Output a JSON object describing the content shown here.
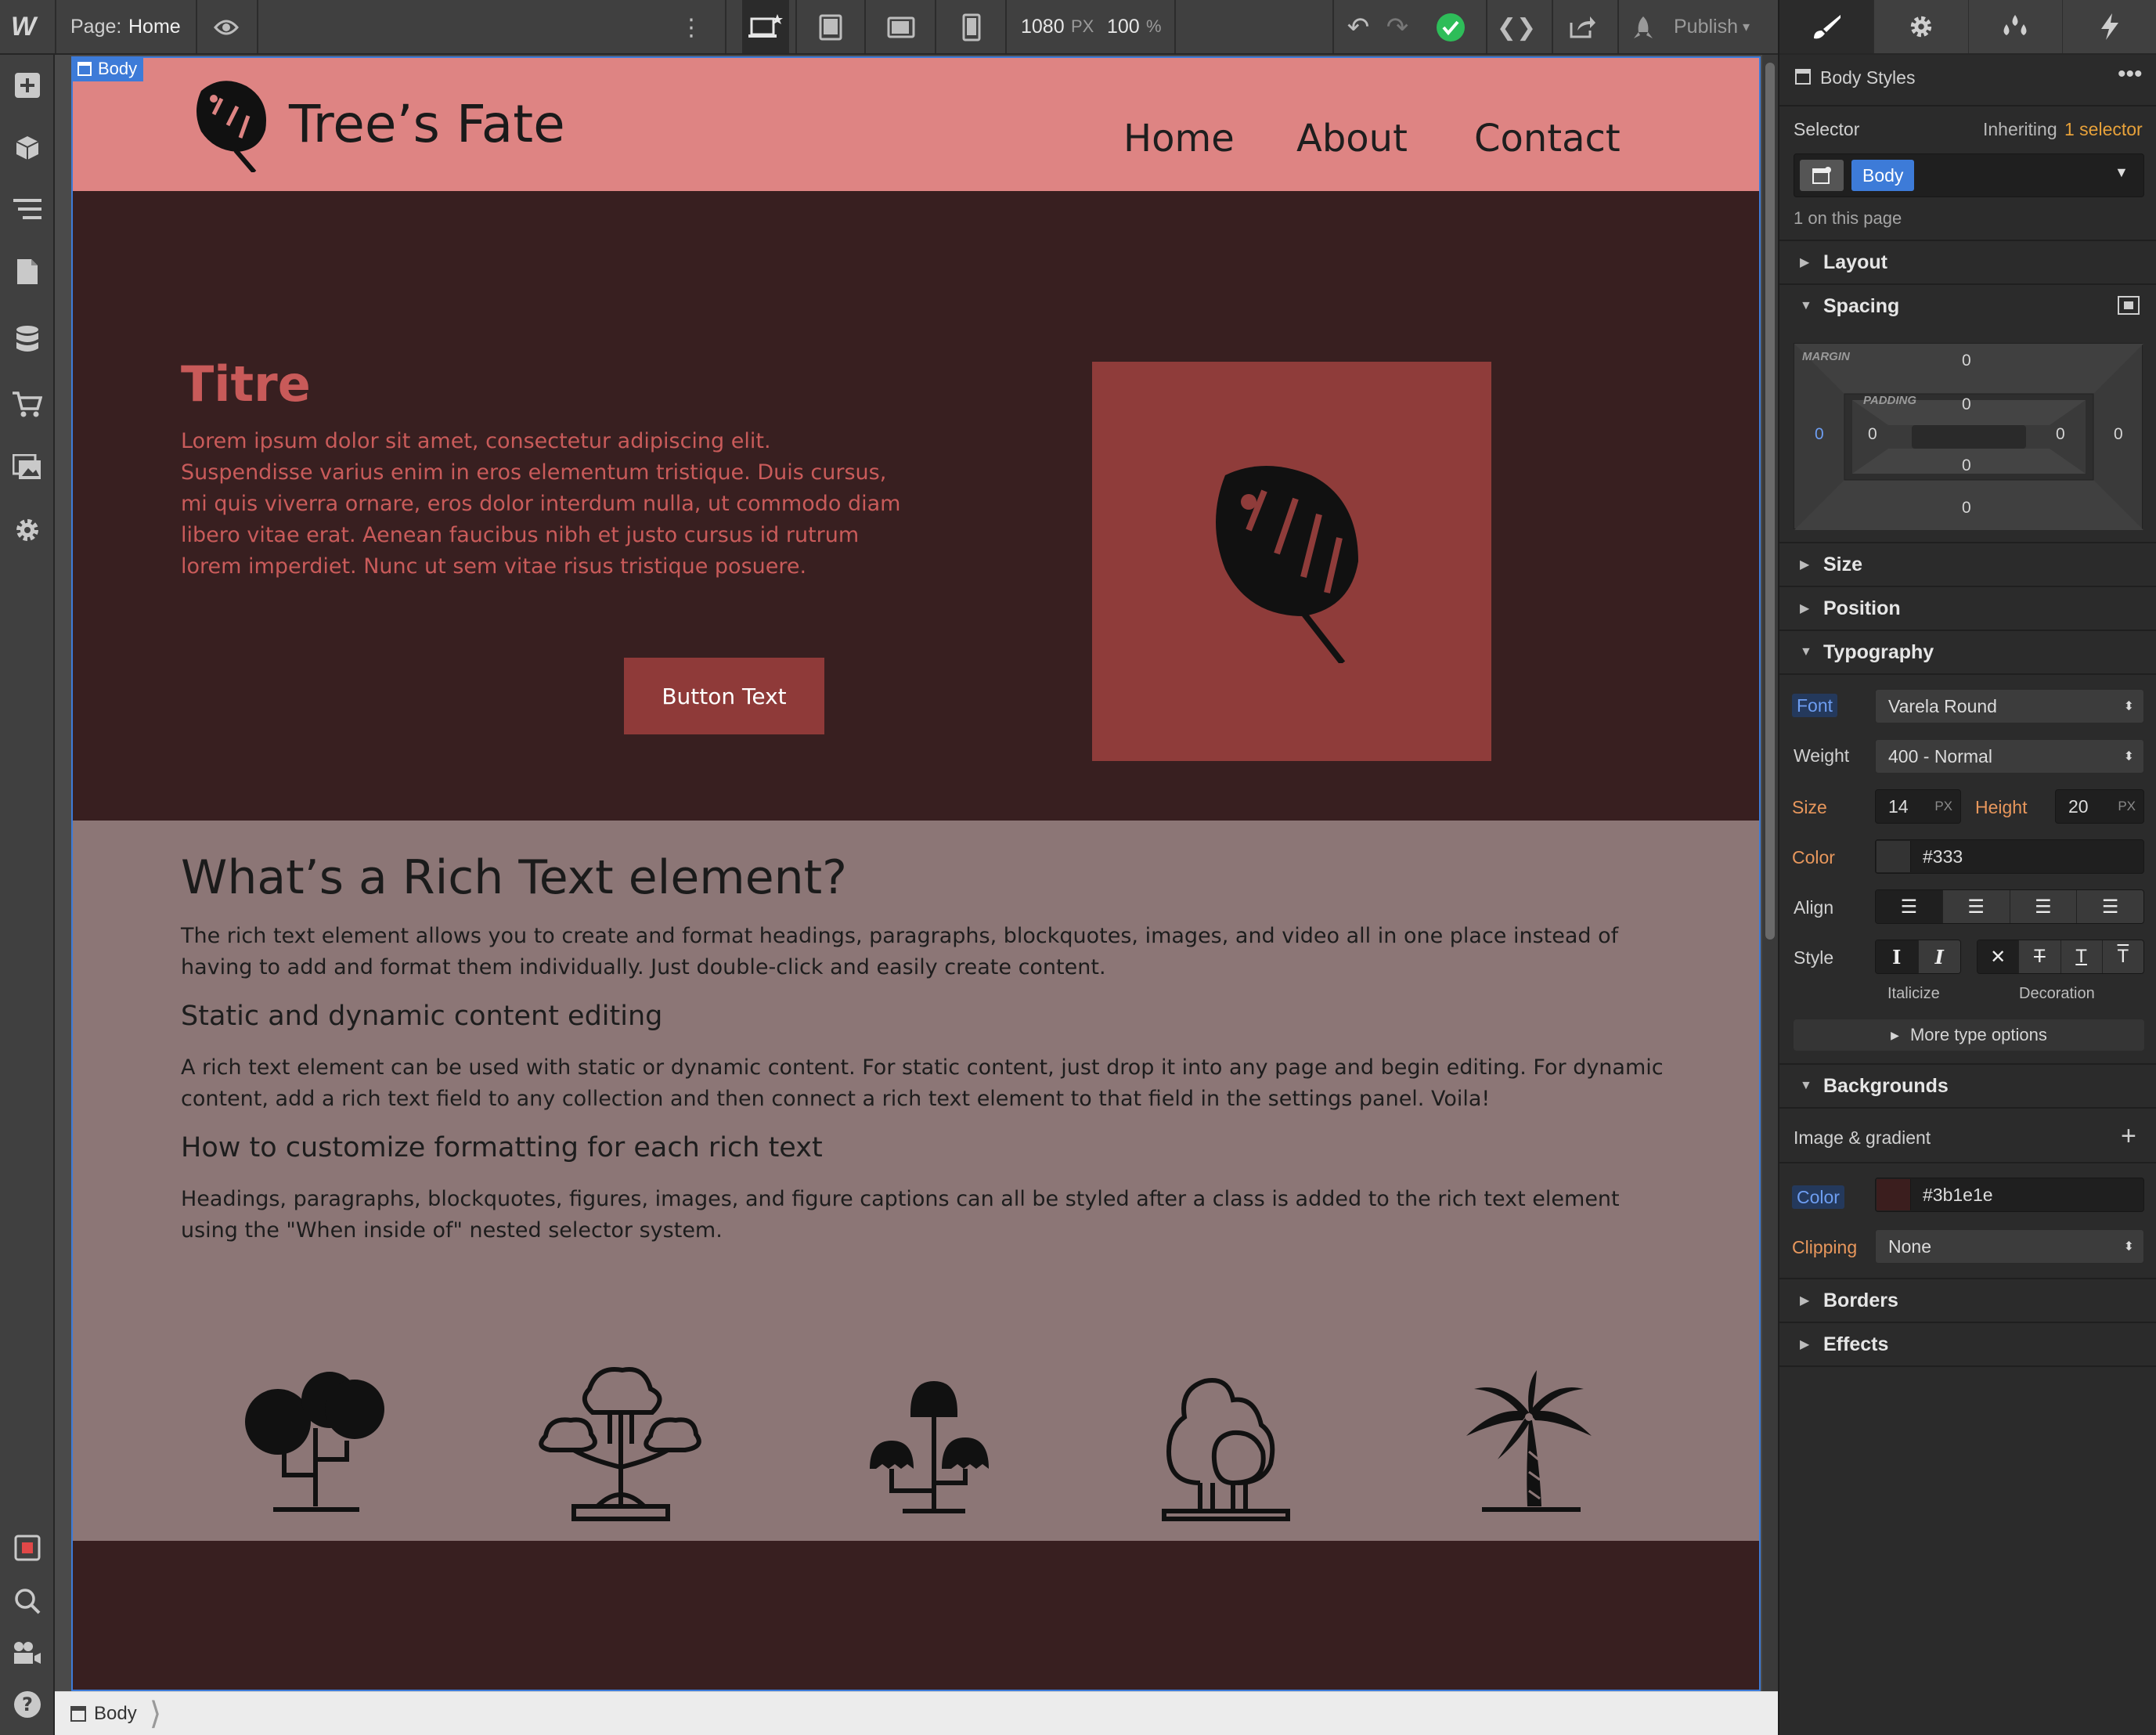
{
  "topbar": {
    "logo": "W",
    "page_prefix": "Page:",
    "page_name": "Home",
    "width_value": "1080",
    "width_unit": "PX",
    "zoom_value": "100",
    "zoom_unit": "%",
    "publish_label": "Publish"
  },
  "site": {
    "body_tag": "Body",
    "brand": "Tree’s Fate",
    "nav": [
      "Home",
      "About",
      "Contact"
    ],
    "hero": {
      "title": "Titre",
      "text": "Lorem ipsum dolor sit amet, consectetur adipiscing elit. Suspendisse varius enim in eros elementum tristique. Duis cursus, mi quis viverra ornare, eros dolor interdum nulla, ut commodo diam libero vitae erat. Aenean faucibus nibh et justo cursus id rutrum lorem imperdiet. Nunc ut sem vitae risus tristique posuere.",
      "button": "Button Text"
    },
    "rich": {
      "h2": "What’s a Rich Text element?",
      "p1": "The rich text element allows you to create and format headings, paragraphs, blockquotes, images, and video all in one place instead of having to add and format them individually. Just double-click and easily create content.",
      "h3a": "Static and dynamic content editing",
      "p2": "A rich text element can be used with static or dynamic content. For static content, just drop it into any page and begin editing. For dynamic content, add a rich text field to any collection and then connect a rich text element to that field in the settings panel. Voila!",
      "h3b": "How to customize formatting for each rich text",
      "p3": "Headings, paragraphs, blockquotes, figures, images, and figure captions can all be styled after a class is added to the rich text element using the \"When inside of\" nested selector system."
    },
    "trees": [
      "round-tree-icon",
      "bonsai-tree-icon",
      "mushroom-tree-icon",
      "bush-tree-icon",
      "palm-tree-icon"
    ]
  },
  "breadcrumb": {
    "item": "Body"
  },
  "panel": {
    "header": "Body Styles",
    "selector_label": "Selector",
    "inheriting_prefix": "Inheriting",
    "inheriting_link": "1 selector",
    "selector_tag": "Body",
    "on_page": "1 on this page",
    "sections": {
      "layout": "Layout",
      "spacing": "Spacing",
      "size": "Size",
      "position": "Position",
      "typography": "Typography",
      "backgrounds": "Backgrounds",
      "borders": "Borders",
      "effects": "Effects"
    },
    "spacing": {
      "margin_label": "MARGIN",
      "padding_label": "PADDING",
      "margin_top": "0",
      "margin_left": "0",
      "margin_right": "0",
      "margin_bottom": "0",
      "padding_top": "0",
      "padding_left": "0",
      "padding_right": "0",
      "padding_bottom": "0"
    },
    "typography": {
      "font_label": "Font",
      "font_value": "Varela Round",
      "weight_label": "Weight",
      "weight_value": "400 - Normal",
      "size_label": "Size",
      "size_value": "14",
      "size_unit": "PX",
      "height_label": "Height",
      "height_value": "20",
      "height_unit": "PX",
      "color_label": "Color",
      "color_value": "#333",
      "align_label": "Align",
      "style_label": "Style",
      "italicize_label": "Italicize",
      "decoration_label": "Decoration",
      "more_label": "More type options"
    },
    "backgrounds": {
      "image_gradient_label": "Image & gradient",
      "color_label": "Color",
      "color_value": "#3b1e1e",
      "clipping_label": "Clipping",
      "clipping_value": "None"
    }
  },
  "colors": {
    "accent": "#3d7bd8",
    "header_bg": "#de8483",
    "hero_bg": "#381f20",
    "hero_accent": "#c85a59",
    "button_bg": "#8f3a39",
    "rich_bg": "#8c7676",
    "status_ok": "#2ebd59"
  }
}
